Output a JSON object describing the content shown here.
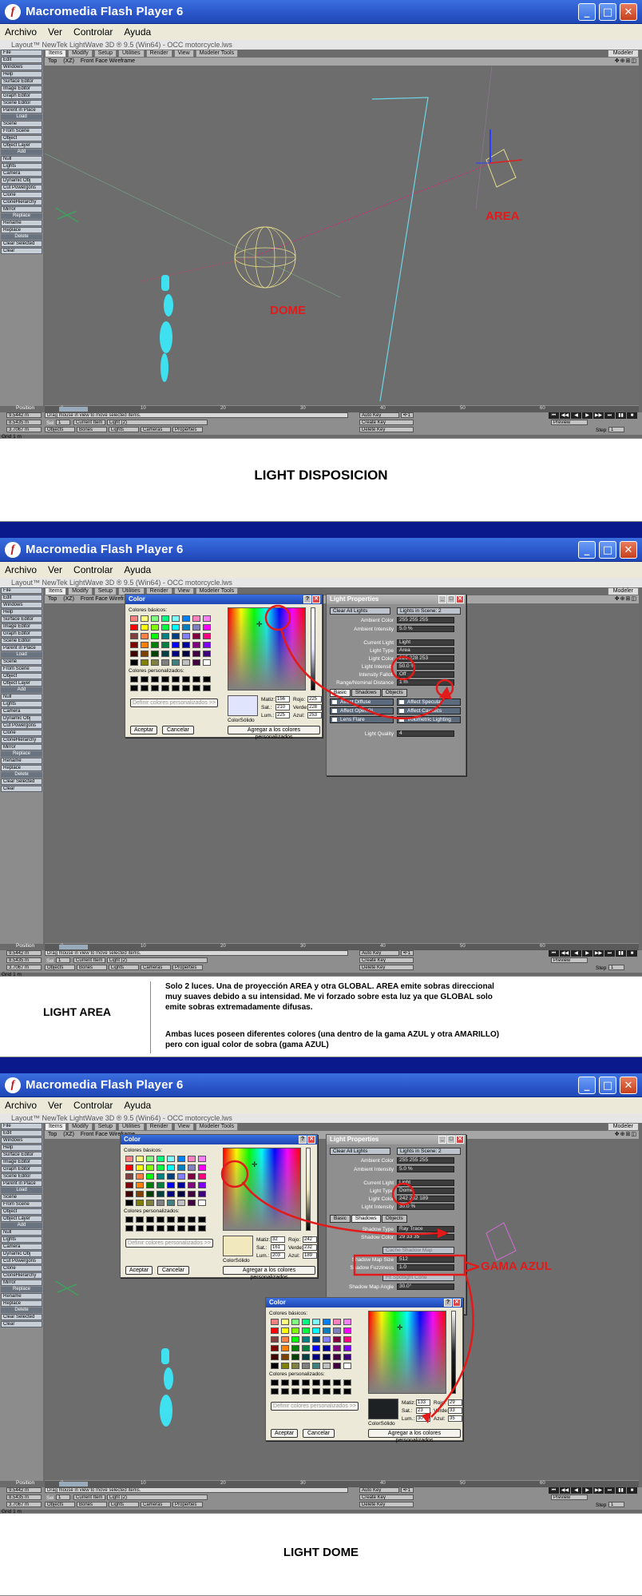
{
  "window": {
    "title": "Macromedia Flash Player 6",
    "menu": [
      "Archivo",
      "Ver",
      "Controlar",
      "Ayuda"
    ]
  },
  "lightwave": {
    "title": "Layout™ NewTek LightWave 3D ® 9.5  (Win64) - OCC motorcycle.lws",
    "tabs": [
      "Items",
      "Modify",
      "Setup",
      "Utilities",
      "Render",
      "View",
      "Modeler Tools"
    ],
    "modeler_label": "Modeler",
    "view": {
      "mode": "Top",
      "xz": "(XZ)",
      "render": "Front Face Wireframe"
    },
    "sidebar": [
      {
        "label": "File",
        "type": "item"
      },
      {
        "label": "Edit",
        "type": "item"
      },
      {
        "label": "Windows",
        "type": "item"
      },
      {
        "label": "Help",
        "type": "item"
      },
      {
        "label": "Surface Editor",
        "type": "item"
      },
      {
        "label": "Image Editor",
        "type": "item"
      },
      {
        "label": "Graph Editor",
        "type": "item"
      },
      {
        "label": "Scene Editor",
        "type": "item"
      },
      {
        "label": "Parent in Place",
        "type": "item"
      },
      {
        "label": "Load",
        "type": "header"
      },
      {
        "label": "Scene",
        "type": "item"
      },
      {
        "label": "From Scene",
        "type": "item"
      },
      {
        "label": "Object",
        "type": "item"
      },
      {
        "label": "Object Layer",
        "type": "item"
      },
      {
        "label": "Add",
        "type": "header"
      },
      {
        "label": "Null",
        "type": "item"
      },
      {
        "label": "Lights",
        "type": "item"
      },
      {
        "label": "Camera",
        "type": "item"
      },
      {
        "label": "Dynamic Obj",
        "type": "item"
      },
      {
        "label": "Cut Powergons",
        "type": "item"
      },
      {
        "label": "Clone",
        "type": "item"
      },
      {
        "label": "CloneHierarchy",
        "type": "item"
      },
      {
        "label": "Mirror",
        "type": "item"
      },
      {
        "label": "Replace",
        "type": "header"
      },
      {
        "label": "Rename",
        "type": "item"
      },
      {
        "label": "Replace",
        "type": "item"
      },
      {
        "label": "Delete",
        "type": "header"
      },
      {
        "label": "Clear Selected",
        "type": "item"
      },
      {
        "label": "Clear",
        "type": "item"
      }
    ],
    "timeline_ticks": [
      "0",
      "10",
      "20",
      "30",
      "40",
      "50",
      "60"
    ],
    "status": {
      "position_label": "Position",
      "x": "9.5442 m",
      "y": "8.5435 m",
      "z": "3.7067 m",
      "grid": "1 m",
      "hint": "Drag mouse in view to move selected items.",
      "current_item_label": "Current Item",
      "current_item_value": "Light (2)",
      "auto_key": "Auto Key",
      "create_key": "Create Key",
      "delete_key": "Delete Key",
      "preview": "Preview",
      "step": "Step",
      "step_value": "1",
      "sel_label": "Sel",
      "sel_value": "1",
      "f1": "•F1",
      "tabs": [
        "Objects",
        "Bones",
        "Lights",
        "Cameras",
        "Properties"
      ]
    }
  },
  "panel1": {
    "labels": [
      "AREA",
      "DOME"
    ],
    "caption": "LIGHT DISPOSICION"
  },
  "panel2": {
    "caption_left": "LIGHT AREA",
    "caption_p1": "Solo 2 luces. Una de proyección AREA y otra GLOBAL. AREA emite sobras direccional muy suaves debido a su intensidad. Me vi forzado sobre esta luz ya que GLOBAL solo emite sobras extremadamente difusas.",
    "caption_p2": "Ambas luces poseen diferentes colores (una dentro de la gama AZUL y otra AMARILLO) pero con igual color de sobra (gama AZUL)"
  },
  "panel3": {
    "gama": "GAMA AZUL",
    "caption": "LIGHT DOME"
  },
  "color_dialog": {
    "title": "Color",
    "basic_label": "Colores básicos:",
    "custom_label": "Colores personalizados:",
    "define_label": "Definir colores personalizados >>",
    "accept": "Aceptar",
    "cancel": "Cancelar",
    "add_custom": "Agregar a los colores personalizados",
    "solid_label": "Color|Sólido",
    "hue_label": "Matiz:",
    "sat_label": "Sat.:",
    "lum_label": "Lum.:",
    "red_label": "Rojo:",
    "green_label": "Verde:",
    "blue_label": "Azul:",
    "p2": {
      "hue": "156",
      "sat": "210",
      "lum": "225",
      "red": "225",
      "green": "228",
      "blue": "253",
      "solid": "#e1e4fd"
    },
    "p3a": {
      "hue": "32",
      "sat": "161",
      "lum": "203",
      "red": "242",
      "green": "232",
      "blue": "189",
      "solid": "#f2e8bd"
    },
    "p3b": {
      "hue": "133",
      "sat": "23",
      "lum": "30",
      "red": "29",
      "green": "33",
      "blue": "35",
      "solid": "#1d2123"
    }
  },
  "swatches": [
    "#ff8080",
    "#ffff80",
    "#80ff80",
    "#00ff80",
    "#80ffff",
    "#0080ff",
    "#ff80c0",
    "#ff80ff",
    "#ff0000",
    "#ffff00",
    "#80ff00",
    "#00ff40",
    "#00ffff",
    "#0080c0",
    "#8080c0",
    "#ff00ff",
    "#804040",
    "#ff8040",
    "#00ff00",
    "#008080",
    "#004080",
    "#8080ff",
    "#800040",
    "#ff0080",
    "#800000",
    "#ff8000",
    "#008000",
    "#008040",
    "#0000ff",
    "#0000a0",
    "#800080",
    "#8000ff",
    "#400000",
    "#804000",
    "#004000",
    "#004040",
    "#000080",
    "#000040",
    "#400040",
    "#400080",
    "#000000",
    "#808000",
    "#808040",
    "#808080",
    "#408080",
    "#c0c0c0",
    "#400040",
    "#ffffff"
  ],
  "light_props": {
    "title": "Light Properties",
    "clear_all": "Clear All Lights",
    "lights_in_scene": "Lights in Scene: 2",
    "ambient_color_label": "Ambient Color",
    "ambient_intensity_label": "Ambient Intensity",
    "ambient_intensity": "5.0 %",
    "current_light_label": "Current Light",
    "current_light": "Light",
    "light_type_label": "Light Type",
    "light_color_label": "Light Color",
    "light_intensity_label": "Light Intensity",
    "falloff_label": "Intensity Falloff",
    "falloff": "Off",
    "range_label": "Range/Nominal Distance",
    "range": "1 m",
    "tabs": [
      "Basic",
      "Shadows",
      "Objects"
    ],
    "basic_checks": [
      "Affect Diffuse",
      "Affect Specular",
      "Affect OpenGL",
      "Affect Caustics",
      "Lens Flare",
      "Volumetric Lighting"
    ],
    "light_quality_label": "Light Quality",
    "light_quality": "4",
    "area": {
      "type": "Area",
      "intensity": "50.0 %",
      "ambient": "255  255  255",
      "color": "225  228  253"
    },
    "dome": {
      "type": "Dome",
      "intensity": "30.0 %",
      "ambient": "255  255  255",
      "color": "242  232  189",
      "shadow_type_label": "Shadow Type",
      "shadow_type": "Ray Trace",
      "shadow_color_label": "Shadow Color",
      "shadow_color": "29  33  35",
      "cache": "Cache Shadow Map",
      "map_size_label": "Shadow Map Size",
      "map_size": "512",
      "fuzz_label": "Shadow Fuzziness",
      "fuzz": "1.0",
      "fit": "Fit Spotlight Cone",
      "map_angle_label": "Shadow Map Angle",
      "map_angle": "30.0°"
    }
  },
  "colors": {
    "red": "#e31a1a",
    "xp_blue": "#2a55c8",
    "lw_gray": "#6d6d6d"
  }
}
